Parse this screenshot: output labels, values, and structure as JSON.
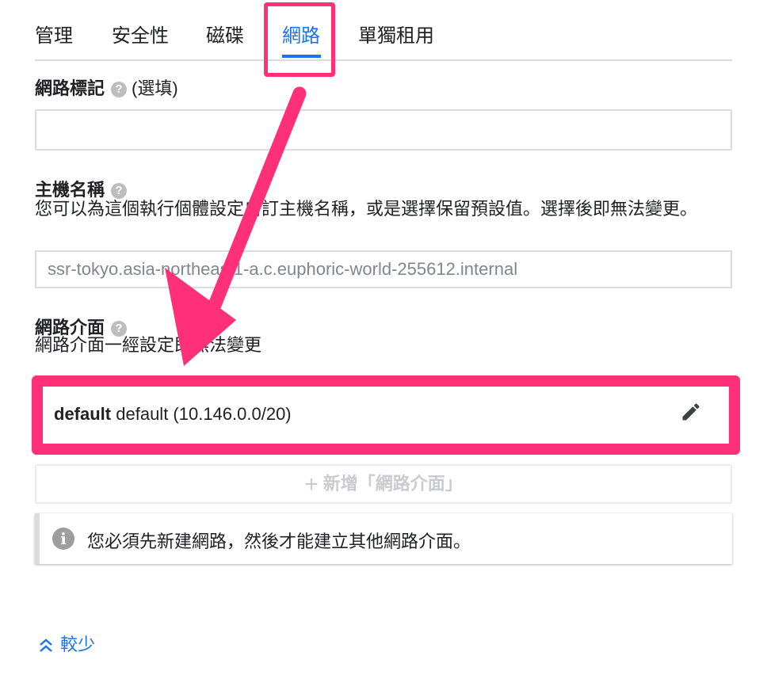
{
  "tabs": [
    {
      "label": "管理"
    },
    {
      "label": "安全性"
    },
    {
      "label": "磁碟"
    },
    {
      "label": "網路",
      "active": true
    },
    {
      "label": "單獨租用"
    }
  ],
  "network_tags": {
    "label": "網路標記",
    "optional": "(選填)",
    "value": ""
  },
  "hostname": {
    "label": "主機名稱",
    "description": "您可以為這個執行個體設定自訂主機名稱，或是選擇保留預設值。選擇後即無法變更。",
    "value": "ssr-tokyo.asia-northeast1-a.c.euphoric-world-255612.internal"
  },
  "network_interfaces": {
    "label": "網路介面",
    "description": "網路介面一經設定即無法變更",
    "items": [
      {
        "name": "default",
        "detail": "default (10.146.0.0/20)"
      }
    ],
    "add_label": "新增「網路介面」"
  },
  "info_banner": {
    "text": "您必須先新建網路，然後才能建立其他網路介面。"
  },
  "less_link": {
    "label": "較少"
  },
  "colors": {
    "accent": "#1a73e8",
    "highlight": "#ff2f78"
  },
  "icons": {
    "help": "question-mark-icon",
    "edit": "pencil-icon",
    "info": "info-icon",
    "add": "plus-icon",
    "less": "double-chevron-up-icon"
  }
}
